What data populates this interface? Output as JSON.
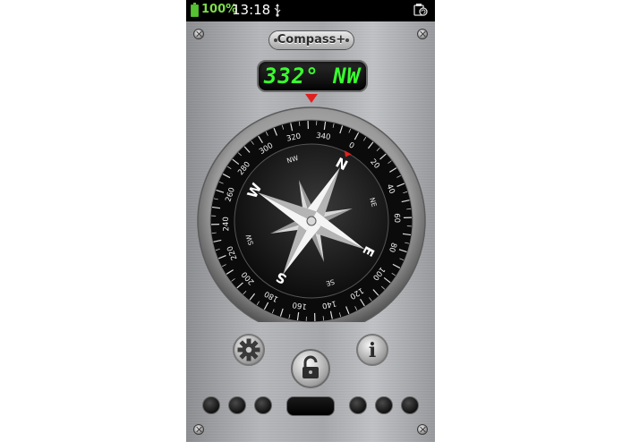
{
  "status_bar": {
    "battery_percent": "100%",
    "time": "13:18",
    "usb_icon": "usb-icon",
    "right_icon": "sync-settings-icon"
  },
  "app": {
    "title": "Compass+",
    "heading_readout": "332° NW"
  },
  "compass": {
    "heading_degrees": 332,
    "degree_labels": [
      "0",
      "20",
      "40",
      "60",
      "80",
      "100",
      "120",
      "140",
      "160",
      "180",
      "200",
      "220",
      "240",
      "260",
      "280",
      "300",
      "320",
      "340"
    ],
    "cardinals": [
      "N",
      "E",
      "S",
      "W"
    ],
    "intercardinals": [
      "NE",
      "SE",
      "SW",
      "NW"
    ],
    "pointer_color": "#e02020"
  },
  "controls": {
    "settings_icon": "gear-icon",
    "lock_icon": "unlock-icon",
    "info_icon": "info-icon",
    "info_glyph": "i"
  },
  "colors": {
    "lcd_text": "#39ff2e",
    "battery": "#55c232",
    "needle_red": "#e02020"
  }
}
